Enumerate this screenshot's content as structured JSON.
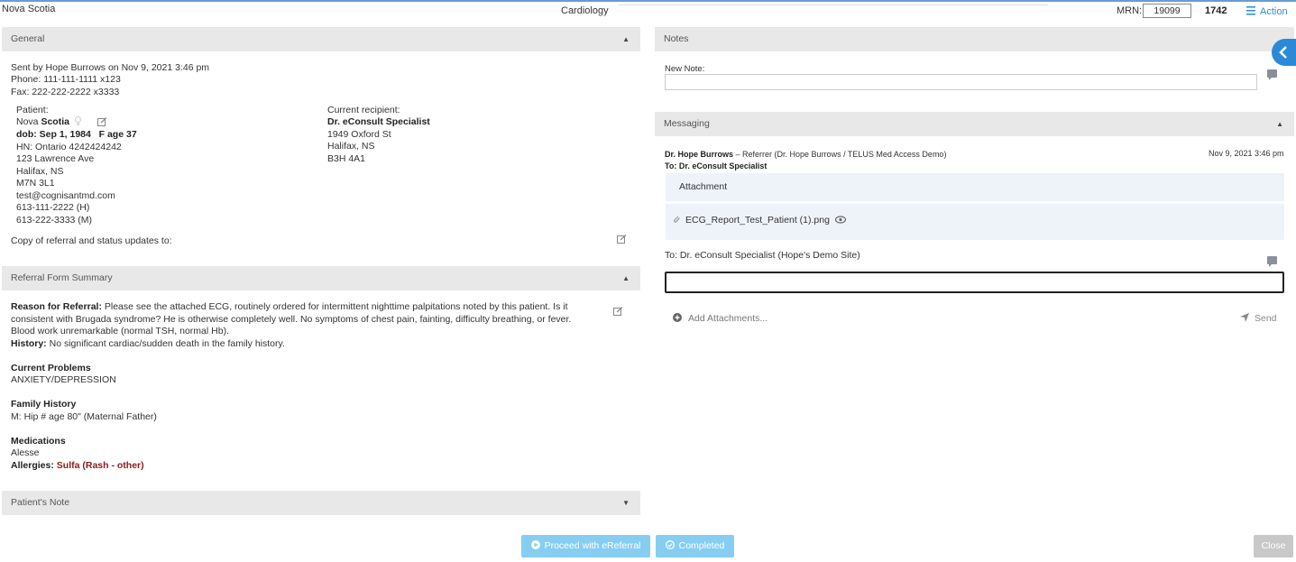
{
  "header": {
    "left_title": "Nova Scotia",
    "center_title": "Cardiology",
    "mrn_label": "MRN:",
    "mrn_value": "19099",
    "id_number": "1742",
    "action_label": "Action",
    "accent_color": "#2b8ad8"
  },
  "general": {
    "header": "General",
    "sent_by": "Sent by Hope Burrows on Nov 9, 2021 3:46 pm",
    "phone": "Phone: 111-111-1111 x123",
    "fax": "Fax: 222-222-2222 x3333",
    "patient_label": "Patient:",
    "patient_first": "Nova",
    "patient_last": "Scotia",
    "dob": "dob: Sep 1, 1984",
    "sex_age": "F age 37",
    "hn": "HN: Ontario 4242424242",
    "address1": "123 Lawrence Ave",
    "address2": "Halifax, NS",
    "postal": "M7N 3L1",
    "email": "test@cognisantmd.com",
    "phone_h": "613-111-2222 (H)",
    "phone_m": "613-222-3333 (M)",
    "recipient_label": "Current recipient:",
    "recipient_name": "Dr. eConsult Specialist",
    "recipient_addr1": "1949 Oxford St",
    "recipient_addr2": "Halifax, NS",
    "recipient_postal": "B3H 4A1",
    "copy_label": "Copy of referral and status updates to:"
  },
  "referral": {
    "header": "Referral Form Summary",
    "reason_label": "Reason for Referral:",
    "reason_line1": "Please see the attached ECG, routinely ordered for intermittent nighttime palpitations noted by this patient. Is it",
    "reason_line2": "consistent with Brugada syndrome? He is otherwise completely well. No symptoms of chest pain, fainting, difficulty breathing, or fever.",
    "reason_line3": "Blood work unremarkable (normal TSH, normal Hb).",
    "history_label": "History:",
    "history_text": "No significant cardiac/sudden death in the family history.",
    "problems_label": "Current Problems",
    "problems_text": "ANXIETY/DEPRESSION",
    "family_label": "Family History",
    "family_text": "M: Hip # age 80\" (Maternal Father)",
    "meds_label": "Medications",
    "meds_text": "Alesse",
    "allergies_label": "Allergies:",
    "allergies_text": "Sulfa (Rash - other)",
    "allergy_color": "#8b1a1a"
  },
  "patients_note": {
    "header": "Patient's Note"
  },
  "notes": {
    "header": "Notes",
    "new_note_label": "New Note:",
    "new_note_value": ""
  },
  "messaging": {
    "header": "Messaging",
    "from_name": "Dr. Hope Burrows",
    "from_role": "– Referrer (Dr. Hope Burrows / TELUS Med Access Demo)",
    "timestamp": "Nov 9, 2021 3:46 pm",
    "to_line": "To: Dr. eConsult Specialist",
    "attachment_label": "Attachment",
    "attachment_file": "ECG_Report_Test_Patient (1).png",
    "reply_to": "To: Dr. eConsult Specialist (Hope's Demo Site)",
    "reply_value": "",
    "add_attachments": "Add Attachments...",
    "send_label": "Send"
  },
  "footer": {
    "proceed_label": "Proceed with eReferral",
    "completed_label": "Completed",
    "close_label": "Close"
  }
}
